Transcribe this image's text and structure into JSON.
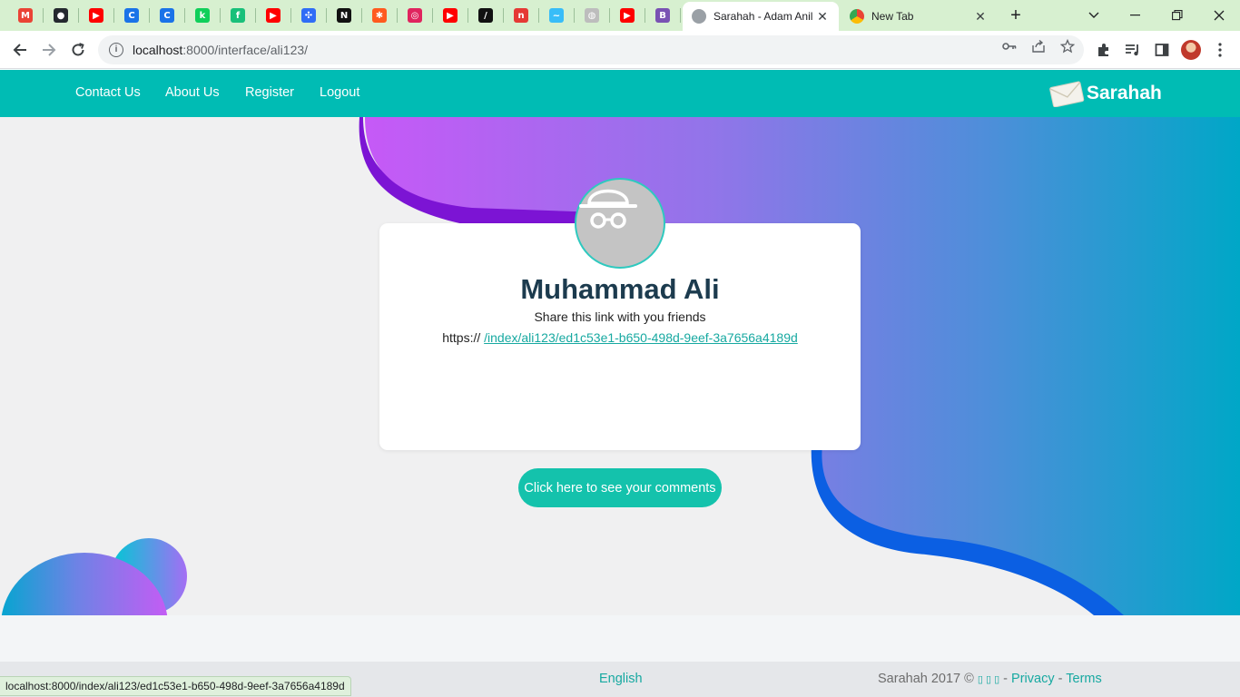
{
  "browser": {
    "pinned_tabs": [
      {
        "icon": "gmail-icon",
        "color": "#ea4335",
        "glyph": "M"
      },
      {
        "icon": "github-icon",
        "color": "#24292f",
        "glyph": "●"
      },
      {
        "icon": "youtube-icon",
        "color": "#ff0000",
        "glyph": "▶"
      },
      {
        "icon": "c-app-icon",
        "color": "#1a73e8",
        "glyph": "C"
      },
      {
        "icon": "c-app-icon",
        "color": "#1a73e8",
        "glyph": "C"
      },
      {
        "icon": "k-app-icon",
        "color": "#0fcf5a",
        "glyph": "k"
      },
      {
        "icon": "fh-app-icon",
        "color": "#19c07a",
        "glyph": "f"
      },
      {
        "icon": "youtube-icon",
        "color": "#ff0000",
        "glyph": "▶"
      },
      {
        "icon": "blocks-icon",
        "color": "#2f6df6",
        "glyph": "✣"
      },
      {
        "icon": "next-icon",
        "color": "#111111",
        "glyph": "N"
      },
      {
        "icon": "asterisk-icon",
        "color": "#ff5a1f",
        "glyph": "✱"
      },
      {
        "icon": "spiral-icon",
        "color": "#e0245e",
        "glyph": "◎"
      },
      {
        "icon": "youtube-icon",
        "color": "#ff0000",
        "glyph": "▶"
      },
      {
        "icon": "slash-app-icon",
        "color": "#111111",
        "glyph": "/"
      },
      {
        "icon": "n-app-icon",
        "color": "#e53935",
        "glyph": "n"
      },
      {
        "icon": "tailwind-icon",
        "color": "#38bdf8",
        "glyph": "~"
      },
      {
        "icon": "globe-icon",
        "color": "#bdbdbd",
        "glyph": "◍"
      },
      {
        "icon": "youtube-icon",
        "color": "#ff0000",
        "glyph": "▶"
      },
      {
        "icon": "bootstrap-icon",
        "color": "#7952b3",
        "glyph": "B"
      }
    ],
    "tabs": [
      {
        "title": "Sarahah - Adam Anil",
        "active": true
      },
      {
        "title": "New Tab",
        "active": false
      }
    ],
    "new_tab_label": "+",
    "url_host": "localhost",
    "url_path": ":8000/interface/ali123/",
    "status_url": "localhost:8000/index/ali123/ed1c53e1-b650-498d-9eef-3a7656a4189d"
  },
  "nav": {
    "links": [
      "Contact Us",
      "About Us",
      "Register",
      "Logout"
    ],
    "brand": "Sarahah"
  },
  "profile": {
    "name": "Muhammad Ali",
    "share_text": "Share this link with you friends",
    "link_prefix": "https://",
    "link": "/index/ali123/ed1c53e1-b650-498d-9eef-3a7656a4189d"
  },
  "comments_button": "Click here to see your comments",
  "footer": {
    "language": "English",
    "copyright": "Sarahah 2017 ©",
    "glyphs": "▯ ▯ ▯",
    "privacy": "Privacy",
    "terms": "Terms",
    "separator": "-"
  },
  "colors": {
    "accent": "#00bcb4",
    "button": "#14c2ac",
    "heading": "#1c3b4e"
  }
}
